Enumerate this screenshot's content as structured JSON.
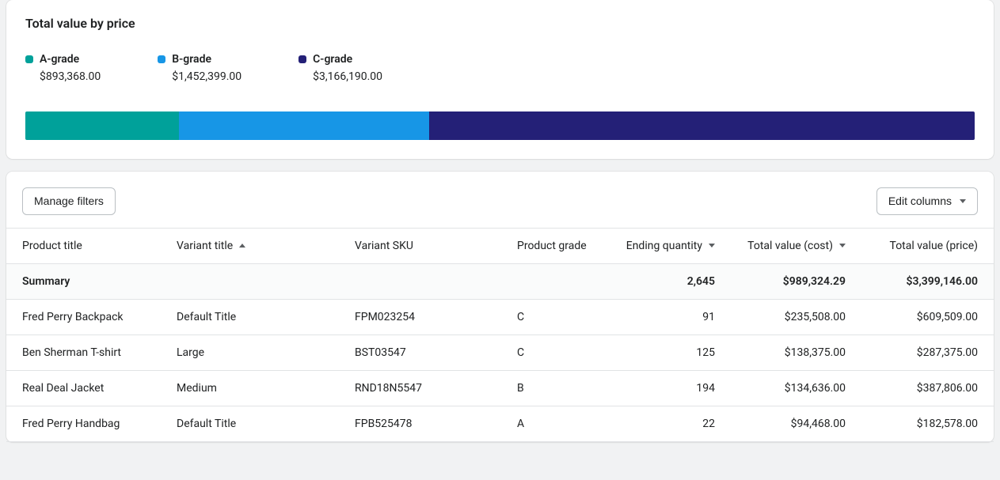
{
  "chart": {
    "title": "Total value by price",
    "legend": [
      {
        "name": "A-grade",
        "value": "$893,368.00",
        "color": "#00A19A"
      },
      {
        "name": "B-grade",
        "value": "$1,452,399.00",
        "color": "#1796E6"
      },
      {
        "name": "C-grade",
        "value": "$3,166,190.00",
        "color": "#242077"
      }
    ]
  },
  "chart_data": {
    "type": "bar",
    "title": "Total value by price",
    "series": [
      {
        "name": "A-grade",
        "values": [
          893368.0
        ],
        "color": "#00A19A"
      },
      {
        "name": "B-grade",
        "values": [
          1452399.0
        ],
        "color": "#1796E6"
      },
      {
        "name": "C-grade",
        "values": [
          3166190.0
        ],
        "color": "#242077"
      }
    ],
    "xlabel": "",
    "ylabel": "",
    "stacked": true
  },
  "toolbar": {
    "manage_filters": "Manage filters",
    "edit_columns": "Edit columns"
  },
  "table": {
    "columns": {
      "product_title": "Product title",
      "variant_title": "Variant title",
      "variant_sku": "Variant SKU",
      "product_grade": "Product grade",
      "ending_quantity": "Ending quantity",
      "total_value_cost": "Total value (cost)",
      "total_value_price": "Total value (price)"
    },
    "summary": {
      "label": "Summary",
      "ending_quantity": "2,645",
      "total_value_cost": "$989,324.29",
      "total_value_price": "$3,399,146.00"
    },
    "rows": [
      {
        "product_title": "Fred Perry Backpack",
        "variant_title": "Default Title",
        "variant_sku": "FPM023254",
        "product_grade": "C",
        "ending_quantity": "91",
        "total_value_cost": "$235,508.00",
        "total_value_price": "$609,509.00"
      },
      {
        "product_title": "Ben Sherman T-shirt",
        "variant_title": "Large",
        "variant_sku": "BST03547",
        "product_grade": "C",
        "ending_quantity": "125",
        "total_value_cost": "$138,375.00",
        "total_value_price": "$287,375.00"
      },
      {
        "product_title": "Real Deal Jacket",
        "variant_title": "Medium",
        "variant_sku": "RND18N5547",
        "product_grade": "B",
        "ending_quantity": "194",
        "total_value_cost": "$134,636.00",
        "total_value_price": "$387,806.00"
      },
      {
        "product_title": "Fred Perry Handbag",
        "variant_title": "Default Title",
        "variant_sku": "FPB525478",
        "product_grade": "A",
        "ending_quantity": "22",
        "total_value_cost": "$94,468.00",
        "total_value_price": "$182,578.00"
      }
    ]
  }
}
